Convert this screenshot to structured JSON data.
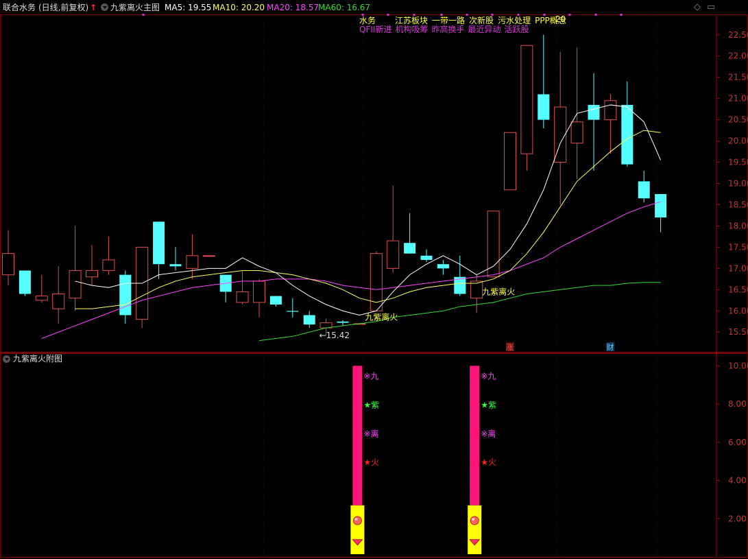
{
  "header": {
    "stock_name": "联合水务",
    "mode": "(日线,前复权)",
    "indicator": "九紫离火主图",
    "ma5": "MA5: 19.55",
    "ma10": "MA10: 20.20",
    "ma20": "MA20: 18.57",
    "ma60": "MA60: 16.67",
    "ma5_color": "#ffffff",
    "ma10_color": "#ffff66",
    "ma20_color": "#ff44ff",
    "ma60_color": "#33dd33"
  },
  "concept_tags": {
    "line1": [
      "水务",
      "江苏板块",
      "一带一路",
      "次新股",
      "污水处理",
      "PPP概念"
    ],
    "line2": [
      "QFII新进",
      "机构吸筹",
      "昨高换手",
      "最近异动",
      "活跃股"
    ],
    "line1_color": "#ffff33",
    "line2_color": "#dd33dd",
    "overlay": "20"
  },
  "sub_panel": {
    "title": "九紫离火附图",
    "signal_chars": [
      "※九",
      "★紫",
      "※离",
      "★火"
    ],
    "signal_colors": [
      "#ff44ff",
      "#33ff33",
      "#ff44ff",
      "#ff2222"
    ],
    "bar_color": "#ff1477",
    "base_color": "#ffff00"
  },
  "chart_data": [
    {
      "type": "candlestick",
      "title": "九紫离火主图",
      "y_axis_ticks": [
        15.5,
        16.0,
        16.5,
        17.0,
        17.5,
        18.0,
        18.5,
        19.0,
        19.5,
        20.0,
        20.5,
        21.0,
        21.5,
        22.0,
        22.5
      ],
      "ylim": [
        15.1,
        22.9
      ],
      "candles": [
        {
          "o": 16.85,
          "h": 17.9,
          "l": 16.6,
          "c": 17.35
        },
        {
          "o": 16.95,
          "h": 16.95,
          "l": 16.35,
          "c": 16.4
        },
        {
          "o": 16.25,
          "h": 16.85,
          "l": 16.2,
          "c": 16.35
        },
        {
          "o": 16.05,
          "h": 17.05,
          "l": 15.7,
          "c": 16.4
        },
        {
          "o": 16.3,
          "h": 18.0,
          "l": 16.0,
          "c": 16.95
        },
        {
          "o": 16.8,
          "h": 17.55,
          "l": 16.6,
          "c": 16.95
        },
        {
          "o": 16.95,
          "h": 17.75,
          "l": 16.85,
          "c": 17.2
        },
        {
          "o": 16.85,
          "h": 16.95,
          "l": 15.7,
          "c": 15.9
        },
        {
          "o": 15.8,
          "h": 17.5,
          "l": 15.6,
          "c": 17.5
        },
        {
          "o": 18.1,
          "h": 18.1,
          "l": 16.75,
          "c": 17.1
        },
        {
          "o": 17.1,
          "h": 17.5,
          "l": 16.95,
          "c": 17.05
        },
        {
          "o": 17.0,
          "h": 17.8,
          "l": 16.75,
          "c": 17.3
        },
        {
          "o": 17.3,
          "h": 17.3,
          "l": 17.3,
          "c": 17.3
        },
        {
          "o": 16.85,
          "h": 16.85,
          "l": 16.2,
          "c": 16.45
        },
        {
          "o": 16.2,
          "h": 16.95,
          "l": 16.15,
          "c": 16.45
        },
        {
          "o": 16.2,
          "h": 16.75,
          "l": 15.85,
          "c": 16.7
        },
        {
          "o": 16.35,
          "h": 16.35,
          "l": 16.1,
          "c": 16.15
        },
        {
          "o": 16.0,
          "h": 16.3,
          "l": 15.85,
          "c": 15.98
        },
        {
          "o": 15.9,
          "h": 16.0,
          "l": 15.6,
          "c": 15.68
        },
        {
          "o": 15.6,
          "h": 15.82,
          "l": 15.42,
          "c": 15.72
        },
        {
          "o": 15.75,
          "h": 15.78,
          "l": 15.65,
          "c": 15.72
        },
        {
          "o": 15.7,
          "h": 15.7,
          "l": 15.7,
          "c": 15.7
        },
        {
          "o": 16.0,
          "h": 17.4,
          "l": 16.0,
          "c": 17.35
        },
        {
          "o": 17.0,
          "h": 18.95,
          "l": 16.9,
          "c": 17.65
        },
        {
          "o": 17.6,
          "h": 18.3,
          "l": 17.35,
          "c": 17.35
        },
        {
          "o": 17.3,
          "h": 17.45,
          "l": 17.15,
          "c": 17.2
        },
        {
          "o": 17.1,
          "h": 17.2,
          "l": 16.85,
          "c": 17.0
        },
        {
          "o": 16.8,
          "h": 17.3,
          "l": 16.35,
          "c": 16.4
        },
        {
          "o": 16.3,
          "h": 16.85,
          "l": 15.95,
          "c": 16.7
        },
        {
          "o": 16.8,
          "h": 18.35,
          "l": 16.8,
          "c": 18.35
        },
        {
          "o": 18.85,
          "h": 20.2,
          "l": 18.85,
          "c": 20.2
        },
        {
          "o": 19.7,
          "h": 22.25,
          "l": 19.3,
          "c": 22.25
        },
        {
          "o": 21.1,
          "h": 22.5,
          "l": 20.3,
          "c": 20.5
        },
        {
          "o": 19.5,
          "h": 22.1,
          "l": 18.5,
          "c": 20.8
        },
        {
          "o": 19.95,
          "h": 22.2,
          "l": 19.1,
          "c": 20.45
        },
        {
          "o": 20.85,
          "h": 21.6,
          "l": 19.3,
          "c": 20.5
        },
        {
          "o": 20.5,
          "h": 21.1,
          "l": 19.7,
          "c": 20.95
        },
        {
          "o": 20.85,
          "h": 21.4,
          "l": 19.4,
          "c": 19.45
        },
        {
          "o": 19.05,
          "h": 19.3,
          "l": 18.55,
          "c": 18.65
        },
        {
          "o": 18.75,
          "h": 18.75,
          "l": 17.85,
          "c": 18.2
        }
      ],
      "ma5": [
        null,
        null,
        null,
        null,
        16.7,
        16.6,
        16.55,
        16.65,
        16.65,
        16.85,
        16.9,
        16.95,
        17.0,
        17.0,
        17.25,
        17.05,
        16.9,
        16.6,
        16.35,
        16.15,
        16.0,
        15.9,
        16.0,
        16.45,
        16.85,
        17.1,
        17.3,
        17.1,
        16.85,
        17.05,
        17.45,
        18.05,
        18.85,
        19.95,
        20.65,
        20.75,
        20.85,
        20.8,
        20.45,
        19.55
      ],
      "ma10": [
        null,
        null,
        null,
        null,
        16.05,
        16.05,
        16.1,
        16.15,
        16.35,
        16.55,
        16.7,
        16.8,
        16.85,
        16.9,
        16.95,
        16.95,
        16.9,
        16.85,
        16.75,
        16.65,
        16.5,
        16.3,
        16.2,
        16.3,
        16.45,
        16.55,
        16.6,
        16.65,
        16.65,
        16.75,
        16.95,
        17.35,
        17.85,
        18.45,
        19.05,
        19.4,
        19.75,
        20.05,
        20.25,
        20.2
      ],
      "ma20": [
        null,
        null,
        15.35,
        15.5,
        15.65,
        15.8,
        15.95,
        16.1,
        16.25,
        16.35,
        16.45,
        16.55,
        16.6,
        16.65,
        16.7,
        16.7,
        16.75,
        16.75,
        16.75,
        16.7,
        16.6,
        16.55,
        16.5,
        16.55,
        16.6,
        16.65,
        16.7,
        16.75,
        16.8,
        16.85,
        16.95,
        17.1,
        17.25,
        17.5,
        17.7,
        17.9,
        18.1,
        18.3,
        18.45,
        18.57
      ],
      "ma60": [
        null,
        null,
        null,
        null,
        null,
        null,
        null,
        null,
        null,
        null,
        null,
        null,
        null,
        null,
        null,
        15.3,
        15.35,
        15.4,
        15.5,
        15.6,
        15.65,
        15.7,
        15.75,
        15.85,
        15.9,
        15.95,
        16.0,
        16.1,
        16.15,
        16.2,
        16.3,
        16.4,
        16.45,
        16.5,
        16.55,
        16.6,
        16.6,
        16.65,
        16.67,
        16.67
      ],
      "annotations": [
        {
          "label": "九紫离火",
          "candle": 21,
          "price": 15.85,
          "color": "#ffff44"
        },
        {
          "label": "九紫离火",
          "candle": 28,
          "price": 16.45,
          "color": "#ffff44"
        },
        {
          "label": "←15.42",
          "candle": 19,
          "price": 15.42,
          "color": "#dddddd"
        }
      ],
      "markers": [
        {
          "label": "涨",
          "candle": 30,
          "color": "#ff5555",
          "bg": "#551111"
        },
        {
          "label": "财",
          "candle": 36,
          "color": "#66ccff",
          "bg": "#113355"
        }
      ]
    },
    {
      "type": "bar",
      "title": "九紫离火附图",
      "y_axis_ticks": [
        2.0,
        4.0,
        6.0,
        8.0,
        10.0
      ],
      "ylim": [
        0,
        10.3
      ],
      "signals": [
        {
          "candle": 21,
          "value": 10.0
        },
        {
          "candle": 28,
          "value": 10.0
        }
      ]
    }
  ]
}
